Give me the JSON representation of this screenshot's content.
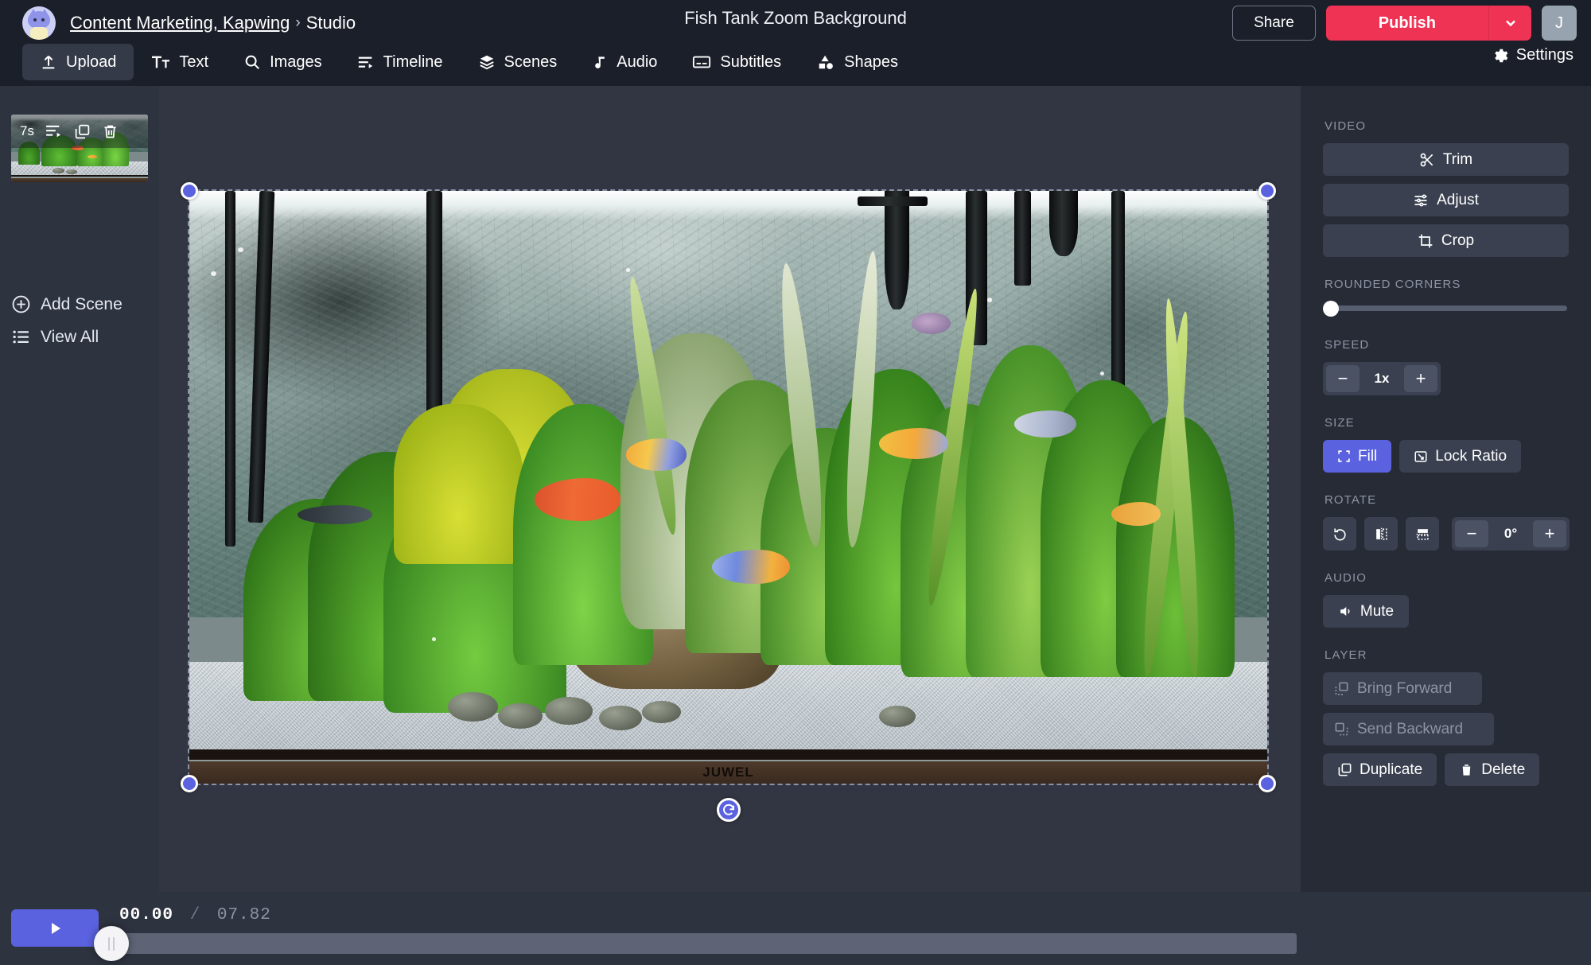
{
  "header": {
    "breadcrumb_link": "Content Marketing, Kapwing",
    "breadcrumb_separator": "›",
    "breadcrumb_current": "Studio",
    "document_title": "Fish Tank Zoom Background",
    "share_label": "Share",
    "publish_label": "Publish",
    "avatar_initial": "J",
    "settings_label": "Settings",
    "accent_publish": "#ef3355",
    "accent_primary": "#5b62e0"
  },
  "tools": [
    {
      "label": "Upload",
      "icon": "upload-icon",
      "active": true
    },
    {
      "label": "Text",
      "icon": "text-icon",
      "active": false
    },
    {
      "label": "Images",
      "icon": "search-icon",
      "active": false
    },
    {
      "label": "Timeline",
      "icon": "timeline-icon",
      "active": false
    },
    {
      "label": "Scenes",
      "icon": "layers-icon",
      "active": false
    },
    {
      "label": "Audio",
      "icon": "music-note-icon",
      "active": false
    },
    {
      "label": "Subtitles",
      "icon": "subtitles-icon",
      "active": false
    },
    {
      "label": "Shapes",
      "icon": "shapes-icon",
      "active": false
    }
  ],
  "sidebar": {
    "scene_duration": "7s",
    "add_scene_label": "Add Scene",
    "view_all_label": "View All"
  },
  "canvas": {
    "brand_text": "JUWEL"
  },
  "panel": {
    "video": {
      "label": "Video",
      "buttons": [
        {
          "label": "Trim",
          "icon": "scissors-icon"
        },
        {
          "label": "Adjust",
          "icon": "sliders-icon"
        },
        {
          "label": "Crop",
          "icon": "crop-icon"
        }
      ]
    },
    "rounded_corners": {
      "label": "Rounded Corners",
      "value": 0
    },
    "speed": {
      "label": "Speed",
      "value": "1x",
      "minus": "−",
      "plus": "+"
    },
    "size": {
      "label": "Size",
      "fill_label": "Fill",
      "lock_ratio_label": "Lock Ratio",
      "fill_selected": true
    },
    "rotate": {
      "label": "Rotate",
      "value": "0°",
      "minus": "−",
      "plus": "+",
      "icons": [
        "rotate-icon",
        "flip-horizontal-icon",
        "flip-vertical-icon"
      ]
    },
    "audio": {
      "label": "Audio",
      "mute_label": "Mute"
    },
    "layer": {
      "label": "Layer",
      "bring_forward_label": "Bring Forward",
      "send_backward_label": "Send Backward",
      "duplicate_label": "Duplicate",
      "delete_label": "Delete"
    }
  },
  "player": {
    "current_time": "00.00",
    "separator": "/",
    "total_time": "07.82",
    "progress_percent": 0
  }
}
